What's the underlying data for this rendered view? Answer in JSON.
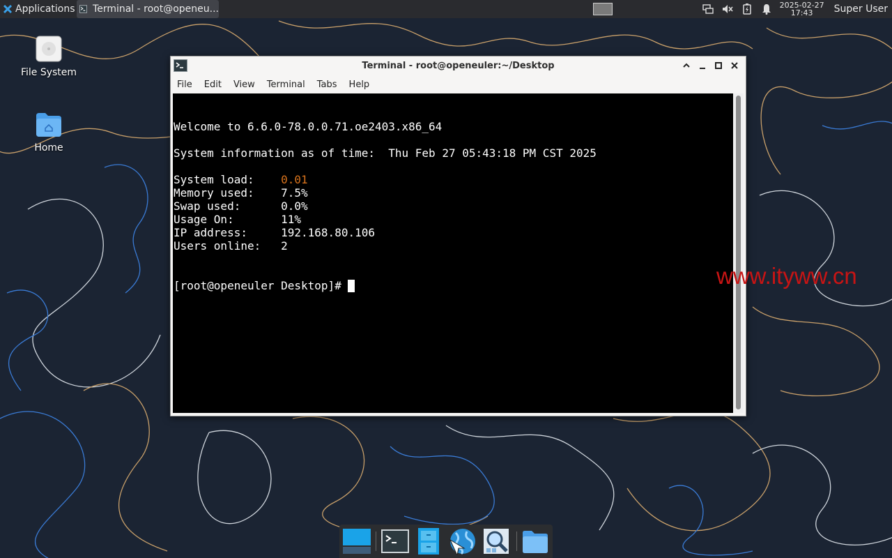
{
  "top_panel": {
    "applications_label": "Applications",
    "task_label": "Terminal - root@openeu...",
    "clock_date": "2025-02-27",
    "clock_time": "17:43",
    "user_label": "Super User",
    "icons": [
      "applications-menu-icon",
      "terminal-icon",
      "workspace-icon",
      "network-icon",
      "volume-muted-icon",
      "battery-icon",
      "notifications-icon"
    ]
  },
  "desktop": {
    "icons": [
      {
        "label": "File System",
        "icon": "drive-icon"
      },
      {
        "label": "Home",
        "icon": "home-folder-icon"
      }
    ]
  },
  "terminal_window": {
    "title": "Terminal - root@openeuler:~/Desktop",
    "menu": [
      "File",
      "Edit",
      "View",
      "Terminal",
      "Tabs",
      "Help"
    ],
    "welcome_line": "Welcome to 6.6.0-78.0.0.71.oe2403.x86_64",
    "sysinfo_line": "System information as of time:  Thu Feb 27 05:43:18 PM CST 2025",
    "stats": [
      {
        "label": "System load:    ",
        "value": "0.01",
        "color": "#d9731c"
      },
      {
        "label": "Memory used:    ",
        "value": "7.5%"
      },
      {
        "label": "Swap used:      ",
        "value": "0.0%"
      },
      {
        "label": "Usage On:       ",
        "value": "11%"
      },
      {
        "label": "IP address:     ",
        "value": "192.168.80.106"
      },
      {
        "label": "Users online:   ",
        "value": "2"
      }
    ],
    "prompt": "[root@openeuler Desktop]# "
  },
  "watermark": "www.ityww.cn",
  "dock": {
    "items": [
      "show-desktop-icon",
      "terminal-icon",
      "file-manager-icon",
      "web-browser-icon",
      "app-finder-icon",
      "folder-icon"
    ]
  }
}
